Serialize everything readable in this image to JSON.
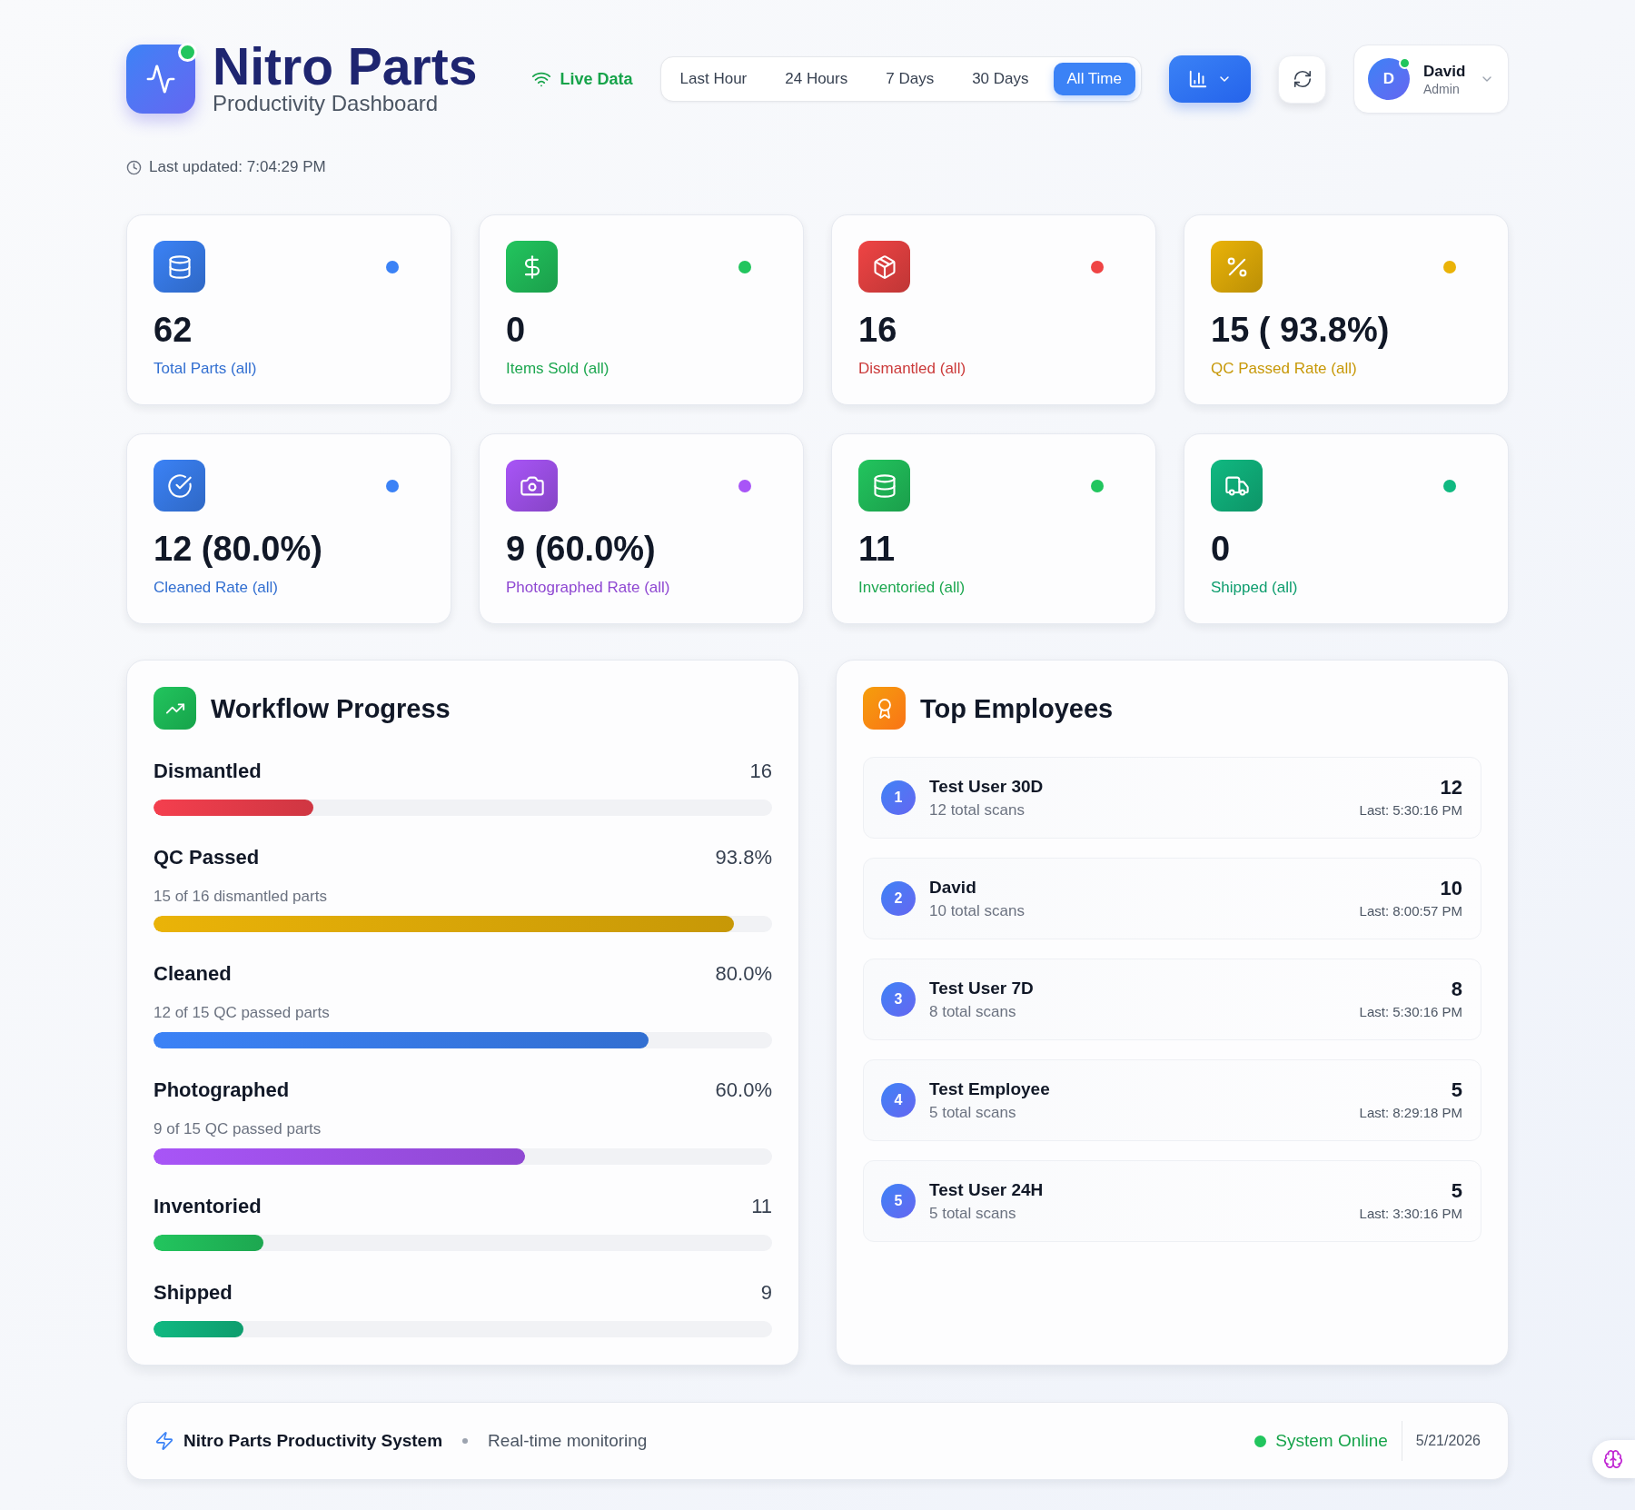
{
  "header": {
    "title": "Nitro Parts",
    "subtitle": "Productivity Dashboard",
    "live_label": "Live Data",
    "time_ranges": [
      {
        "label": "Last Hour",
        "selected": false
      },
      {
        "label": "24 Hours",
        "selected": false
      },
      {
        "label": "7 Days",
        "selected": false
      },
      {
        "label": "30 Days",
        "selected": false
      },
      {
        "label": "All Time",
        "selected": true
      }
    ],
    "user": {
      "initial": "D",
      "name": "David",
      "role": "Admin"
    },
    "last_updated": "Last updated: 7:04:29 PM"
  },
  "stats": [
    {
      "value": "62",
      "label": "Total Parts (all)",
      "color": "#3b82f6"
    },
    {
      "value": "0",
      "label": "Items Sold (all)",
      "color": "#22c55e"
    },
    {
      "value": "16",
      "label": "Dismantled (all)",
      "color": "#ef4444"
    },
    {
      "value": "15 ( 93.8%)",
      "label": "QC Passed Rate (all)",
      "color": "#eab308"
    },
    {
      "value": "12 (80.0%)",
      "label": "Cleaned Rate (all)",
      "color": "#3b82f6"
    },
    {
      "value": "9 (60.0%)",
      "label": "Photographed Rate (all)",
      "color": "#a855f7"
    },
    {
      "value": "11",
      "label": "Inventoried (all)",
      "color": "#22c55e"
    },
    {
      "value": "0",
      "label": "Shipped (all)",
      "color": "#10b981"
    }
  ],
  "workflow": {
    "title": "Workflow Progress",
    "rows": [
      {
        "label": "Dismantled",
        "value": "16",
        "level": 0.258,
        "color": "#f43f4e"
      },
      {
        "label": "QC Passed",
        "value": "93.8%",
        "detail": "15 of 16 dismantled parts",
        "level": 0.938,
        "color": "#eab308"
      },
      {
        "label": "Cleaned",
        "value": "80.0%",
        "detail": "12 of 15 QC passed parts",
        "level": 0.8,
        "color": "#3b82f6"
      },
      {
        "label": "Photographed",
        "value": "60.0%",
        "detail": "9 of 15 QC passed parts",
        "level": 0.6,
        "color": "#a855f7"
      },
      {
        "label": "Inventoried",
        "value": "11",
        "level": 0.177,
        "color": "#22c55e"
      },
      {
        "label": "Shipped",
        "value": "9",
        "level": 0.145,
        "color": "#10b981"
      }
    ]
  },
  "top_employees": {
    "title": "Top Employees",
    "rows": [
      {
        "rank": "1",
        "name": "Test User 30D",
        "scans": "12 total scans",
        "count": "12",
        "last": "Last: 5:30:16 PM"
      },
      {
        "rank": "2",
        "name": "David",
        "scans": "10 total scans",
        "count": "10",
        "last": "Last: 8:00:57 PM"
      },
      {
        "rank": "3",
        "name": "Test User 7D",
        "scans": "8 total scans",
        "count": "8",
        "last": "Last: 5:30:16 PM"
      },
      {
        "rank": "4",
        "name": "Test Employee",
        "scans": "5 total scans",
        "count": "5",
        "last": "Last: 8:29:18 PM"
      },
      {
        "rank": "5",
        "name": "Test User 24H",
        "scans": "5 total scans",
        "count": "5",
        "last": "Last: 3:30:16 PM"
      }
    ]
  },
  "footer": {
    "title": "Nitro Parts Productivity System",
    "subtitle": "Real-time monitoring",
    "status": "System Online",
    "date": "5/21/2026"
  }
}
